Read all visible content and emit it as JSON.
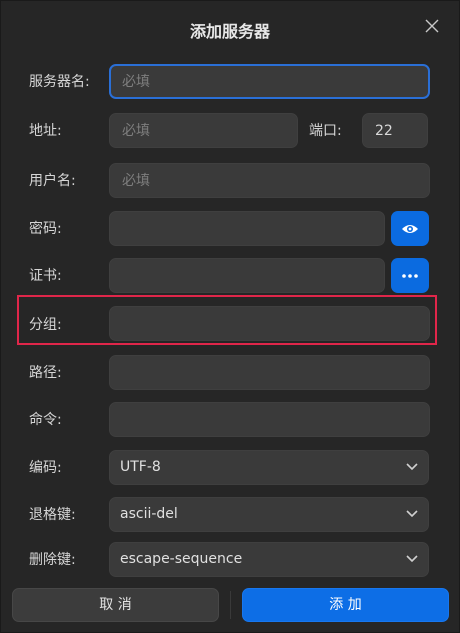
{
  "dialog": {
    "title": "添加服务器"
  },
  "form": {
    "server_name": {
      "label": "服务器名:",
      "placeholder": "必填",
      "value": ""
    },
    "address": {
      "label": "地址:",
      "placeholder": "必填",
      "value": ""
    },
    "port": {
      "label": "端口:",
      "value": "22"
    },
    "username": {
      "label": "用户名:",
      "placeholder": "必填",
      "value": ""
    },
    "password": {
      "label": "密码:",
      "value": ""
    },
    "certificate": {
      "label": "证书:",
      "value": ""
    },
    "group": {
      "label": "分组:",
      "value": ""
    },
    "path": {
      "label": "路径:",
      "value": ""
    },
    "command": {
      "label": "命令:",
      "value": ""
    },
    "encoding": {
      "label": "编码:",
      "selected": "UTF-8"
    },
    "backspace_key": {
      "label": "退格键:",
      "selected": "ascii-del"
    },
    "delete_key": {
      "label": "删除键:",
      "selected": "escape-sequence"
    }
  },
  "footer": {
    "cancel_label": "取 消",
    "add_label": "添 加"
  },
  "colors": {
    "accent": "#0d6ee6",
    "focus_border": "#2a6fd6",
    "highlight": "#e0264a",
    "background": "#262626",
    "field_bg": "#3a3a3a"
  },
  "icons": {
    "close": "close-icon",
    "password_toggle": "eye-icon",
    "certificate_browse": "more-icon",
    "dropdown": "chevron-down-icon"
  }
}
